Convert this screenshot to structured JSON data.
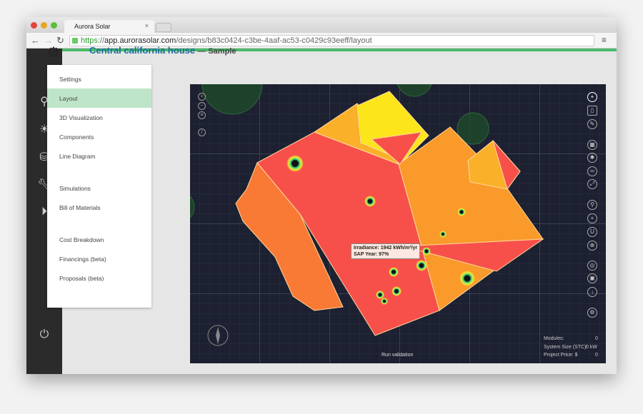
{
  "browser": {
    "tab_title": "Aurora Solar",
    "url_scheme": "https",
    "url_domain": "app.aurorasolar.com",
    "url_path": "/designs/b83c0424-c3be-4aaf-ac53-c0429c93eeff/layout"
  },
  "header": {
    "title": "Central california house",
    "separator": "—",
    "subtitle": "Sample"
  },
  "sidebar_icons": [
    "location-pin-icon",
    "sun-icon",
    "database-icon",
    "wrench-icon",
    "play-icon",
    "power-icon"
  ],
  "menu": {
    "items": [
      {
        "label": "Settings"
      },
      {
        "label": "Layout",
        "active": true
      },
      {
        "label": "3D Visualization"
      },
      {
        "label": "Components"
      },
      {
        "label": "Line Diagram"
      },
      {
        "label": "Simulations"
      },
      {
        "label": "Bill of Materials"
      },
      {
        "label": "Cost Breakdown"
      },
      {
        "label": "Financings (beta)"
      },
      {
        "label": "Proposals (beta)"
      }
    ]
  },
  "tooltip": {
    "line1": "Irradiance: 1942 kWh/m²/yr",
    "line2": "SAP Year: 97%"
  },
  "stats": {
    "modules_label": "Modules:",
    "modules_value": "0",
    "size_label": "System Size (STC):",
    "size_value": "0 kW",
    "price_label": "Project Price: $",
    "price_value": "0"
  },
  "run_validation": "Run validation",
  "colors": {
    "accent": "#4cba6a",
    "title": "#1a6d9a",
    "active_menu": "#bfe5c8",
    "canvas": "#1c2030"
  }
}
